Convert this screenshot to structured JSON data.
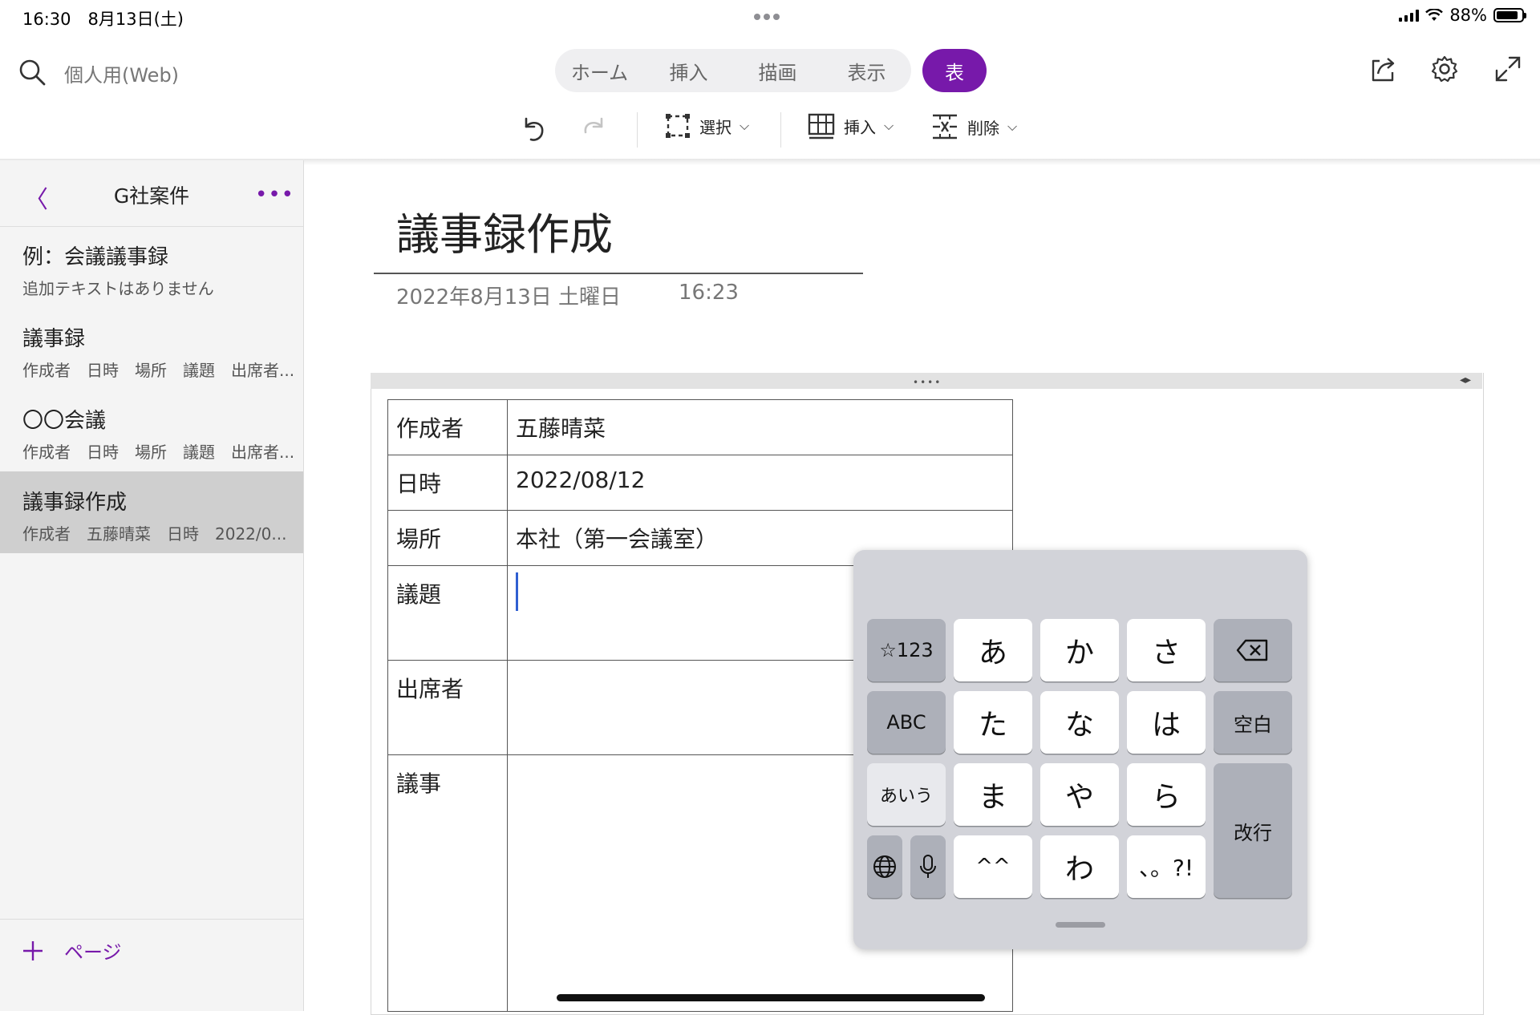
{
  "status_bar": {
    "time_date": "16:30　8月13日(土)",
    "battery": "88%",
    "battery_level": 0.88
  },
  "header": {
    "search_placeholder": "個人用(Web)",
    "tabs": [
      "ホーム",
      "挿入",
      "描画",
      "表示"
    ],
    "active_tab": "表",
    "accent_color": "#7719aa"
  },
  "toolbar": {
    "select_label": "選択",
    "insert_label": "挿入",
    "delete_label": "削除"
  },
  "sidebar": {
    "section_title": "G社案件",
    "pages": [
      {
        "title": "例：会議議事録",
        "subtitle": "追加テキストはありません"
      },
      {
        "title": "議事録",
        "subtitle": "作成者　日時　場所　議題　出席者..."
      },
      {
        "title": "〇〇会議",
        "subtitle": "作成者　日時　場所　議題　出席者..."
      },
      {
        "title": "議事録作成",
        "subtitle": "作成者　五藤晴菜　日時　2022/0..."
      }
    ],
    "add_page_label": "ページ"
  },
  "page": {
    "title": "議事録作成",
    "date": "2022年8月13日 土曜日",
    "time": "16:23"
  },
  "table": {
    "rows": [
      {
        "label": "作成者",
        "value": "五藤晴菜"
      },
      {
        "label": "日時",
        "value": "2022/08/12"
      },
      {
        "label": "場所",
        "value": "本社（第一会議室）"
      },
      {
        "label": "議題",
        "value": ""
      },
      {
        "label": "出席者",
        "value": ""
      },
      {
        "label": "議事",
        "value": ""
      }
    ]
  },
  "keyboard": {
    "keys": {
      "symbols": "☆123",
      "a": "あ",
      "ka": "か",
      "sa": "さ",
      "abc": "ABC",
      "ta": "た",
      "na": "な",
      "ha": "は",
      "space": "空白",
      "aiu": "あいう",
      "ma": "ま",
      "ya": "や",
      "ra": "ら",
      "enter": "改行",
      "kaomoji": "^^",
      "wa": "わ",
      "punct": "、。?!"
    }
  }
}
